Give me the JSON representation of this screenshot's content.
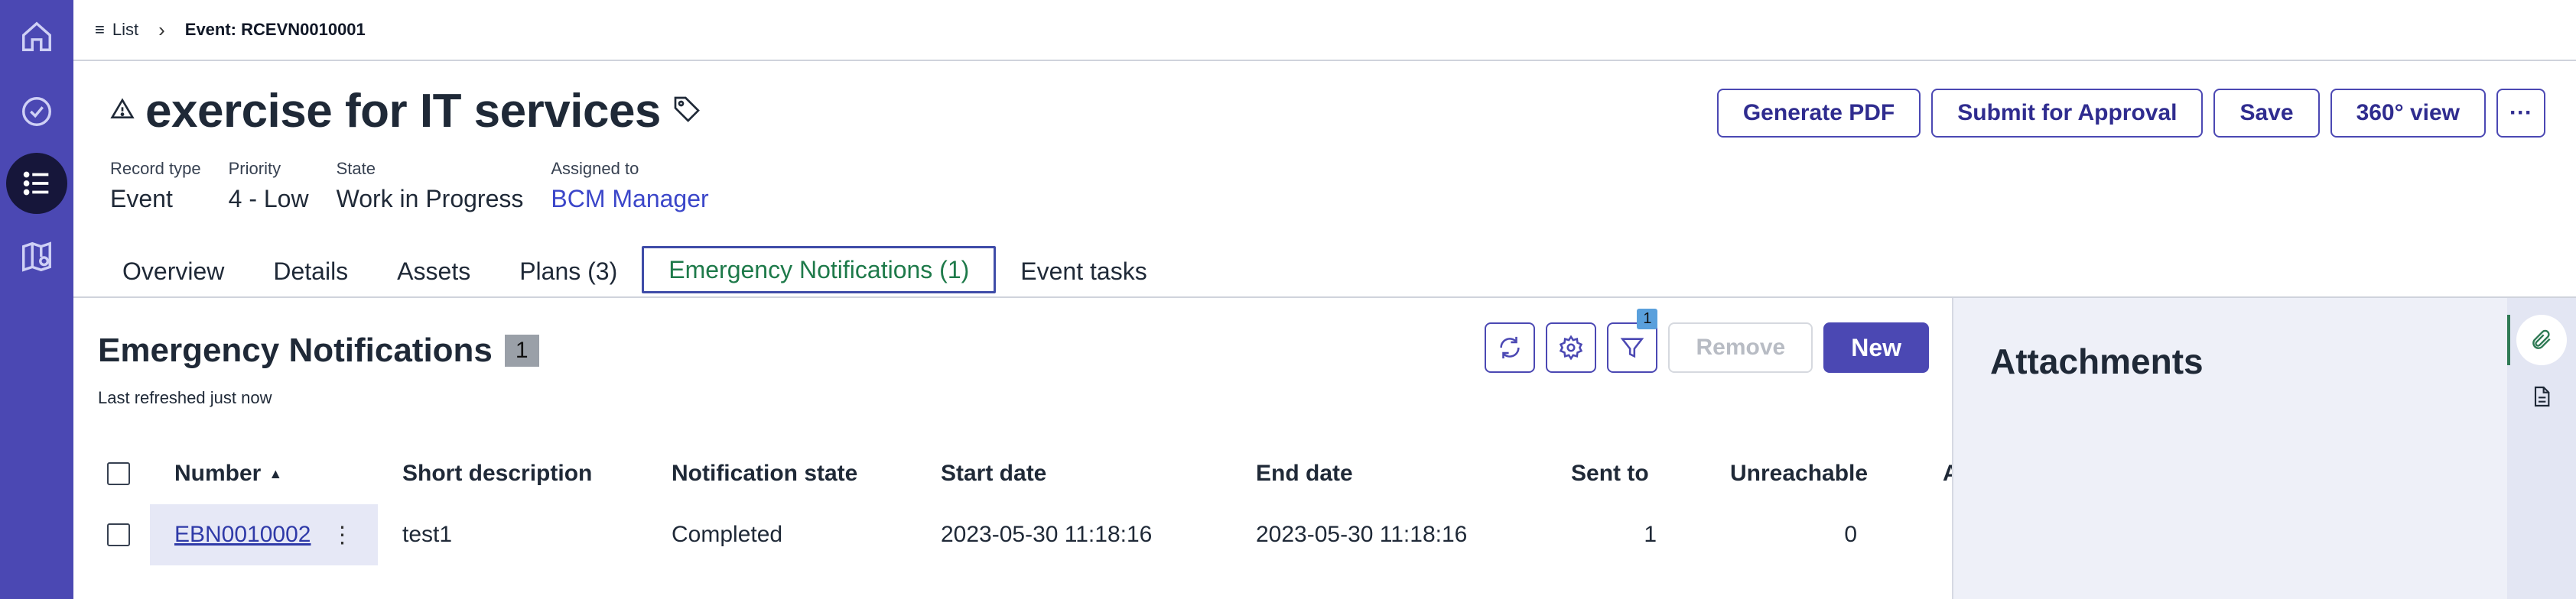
{
  "breadcrumb": {
    "list_label": "List",
    "current": "Event: RCEVN0010001"
  },
  "record": {
    "title": "exercise for IT services",
    "fields": [
      {
        "label": "Record type",
        "value": "Event"
      },
      {
        "label": "Priority",
        "value": "4 - Low"
      },
      {
        "label": "State",
        "value": "Work in Progress"
      },
      {
        "label": "Assigned to",
        "value": "BCM Manager"
      }
    ]
  },
  "actions": {
    "generate_pdf": "Generate PDF",
    "submit_approval": "Submit for Approval",
    "save": "Save",
    "view_360": "360° view",
    "more": "···"
  },
  "tabs": [
    {
      "label": "Overview"
    },
    {
      "label": "Details"
    },
    {
      "label": "Assets"
    },
    {
      "label": "Plans (3)"
    },
    {
      "label": "Emergency Notifications (1)"
    },
    {
      "label": "Event tasks"
    }
  ],
  "list": {
    "title": "Emergency Notifications",
    "count": "1",
    "refreshed": "Last refreshed just now",
    "filter_count": "1",
    "remove_label": "Remove",
    "new_label": "New",
    "columns": [
      "Number",
      "Short description",
      "Notification state",
      "Start date",
      "End date",
      "Sent to",
      "Unreachable",
      "A"
    ],
    "sort_indicator": "▲",
    "rows": [
      {
        "number": "EBN0010002",
        "short_description": "test1",
        "state": "Completed",
        "start": "2023-05-30 11:18:16",
        "end": "2023-05-30 11:18:16",
        "sent_to": "1",
        "unreachable": "0"
      }
    ]
  },
  "attachments": {
    "title": "Attachments"
  },
  "colors": {
    "accent": "#4b48b3",
    "rail_active": "#16163a",
    "tab_active_text": "#1e7a4a",
    "link": "#3b46c9"
  }
}
